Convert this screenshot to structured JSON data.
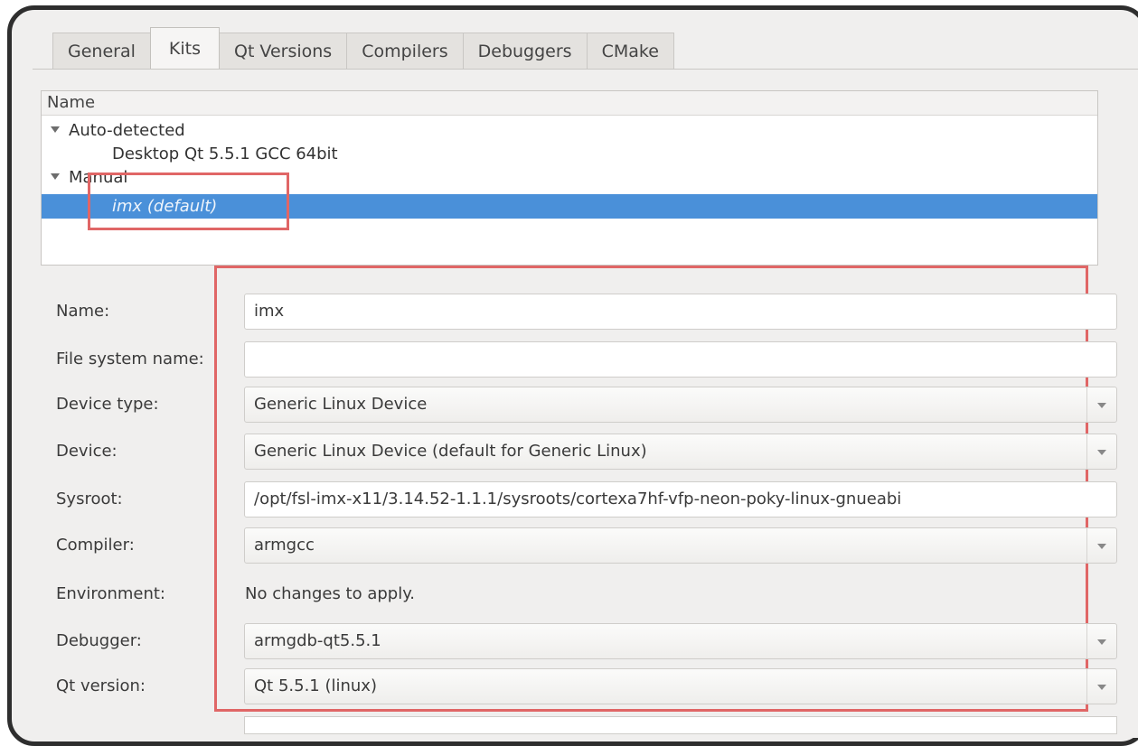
{
  "tabs": [
    "General",
    "Kits",
    "Qt Versions",
    "Compilers",
    "Debuggers",
    "CMake"
  ],
  "active_tab": "Kits",
  "tree": {
    "header": "Name",
    "groups": [
      {
        "label": "Auto-detected",
        "items": [
          "Desktop Qt 5.5.1 GCC 64bit"
        ]
      },
      {
        "label": "Manual",
        "items": [
          "imx (default)"
        ]
      }
    ]
  },
  "form": {
    "name_label": "Name:",
    "name_value": "imx",
    "fs_label": "File system name:",
    "fs_value": "",
    "device_type_label": "Device type:",
    "device_type_value": "Generic Linux Device",
    "device_label": "Device:",
    "device_value": "Generic Linux Device (default for Generic Linux)",
    "sysroot_label": "Sysroot:",
    "sysroot_value": "/opt/fsl-imx-x11/3.14.52-1.1.1/sysroots/cortexa7hf-vfp-neon-poky-linux-gnueabi",
    "compiler_label": "Compiler:",
    "compiler_value": "armgcc",
    "environment_label": "Environment:",
    "environment_value": "No changes to apply.",
    "debugger_label": "Debugger:",
    "debugger_value": "armgdb-qt5.5.1",
    "qt_version_label": "Qt version:",
    "qt_version_value": "Qt 5.5.1 (linux)"
  },
  "colors": {
    "selection": "#4a90d9",
    "highlight_box": "#e06666",
    "frame": "#2e2e2e"
  }
}
